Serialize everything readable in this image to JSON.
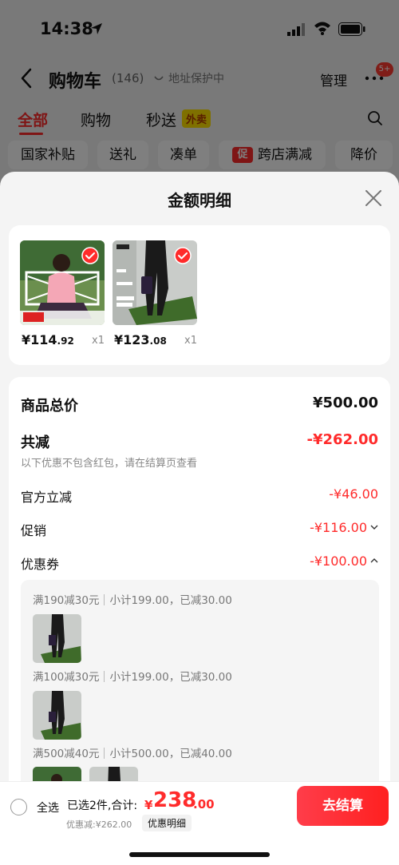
{
  "status_bar": {
    "time": "14:38"
  },
  "header": {
    "title": "购物车",
    "count": "(146)",
    "address_protection": "地址保护中",
    "manage": "管理",
    "more_badge": "5+"
  },
  "tabs": [
    {
      "label": "全部"
    },
    {
      "label": "购物"
    },
    {
      "label": "秒送"
    }
  ],
  "tab_badge": "外卖",
  "chips": [
    {
      "label": "国家补贴"
    },
    {
      "label": "送礼"
    },
    {
      "label": "凑单"
    },
    {
      "label": "跨店满减"
    },
    {
      "label": "降价"
    }
  ],
  "chip_cu_icon": "促",
  "sheet": {
    "title": "金额明细",
    "products": [
      {
        "price_int": "¥114",
        "price_dec": ".92",
        "qty": "x1",
        "image": "woman-pink-top-floral-skirt"
      },
      {
        "price_int": "¥123",
        "price_dec": ".08",
        "qty": "x1",
        "image": "black-pants-on-grass"
      }
    ],
    "total": {
      "label": "商品总价",
      "value": "¥500.00"
    },
    "discount_total": {
      "label": "共减",
      "value": "-¥262.00"
    },
    "discount_note": "以下优惠不包含红包，请在结算页查看",
    "official": {
      "label": "官方立减",
      "value": "-¥46.00"
    },
    "promo": {
      "label": "促销",
      "value": "-¥116.00"
    },
    "coupon": {
      "label": "优惠券",
      "value": "-¥100.00"
    },
    "coupon_lines": [
      {
        "rule": "满190减30元",
        "detail": "小计199.00，已减30.00"
      },
      {
        "rule": "满100减30元",
        "detail": "小计199.00，已减30.00"
      },
      {
        "rule": "满500减40元",
        "detail": "小计500.00，已减40.00"
      }
    ]
  },
  "bottom_bar": {
    "select_all": "全选",
    "summary": "已选2件,合计:",
    "currency": "¥",
    "total_int": "238",
    "total_dec": ".00",
    "discount": "优惠减:¥262.00",
    "detail_button": "优惠明细",
    "checkout": "去结算"
  },
  "colors": {
    "accent": "#ff2b2b",
    "sheet_bg": "#f4f4f4"
  }
}
